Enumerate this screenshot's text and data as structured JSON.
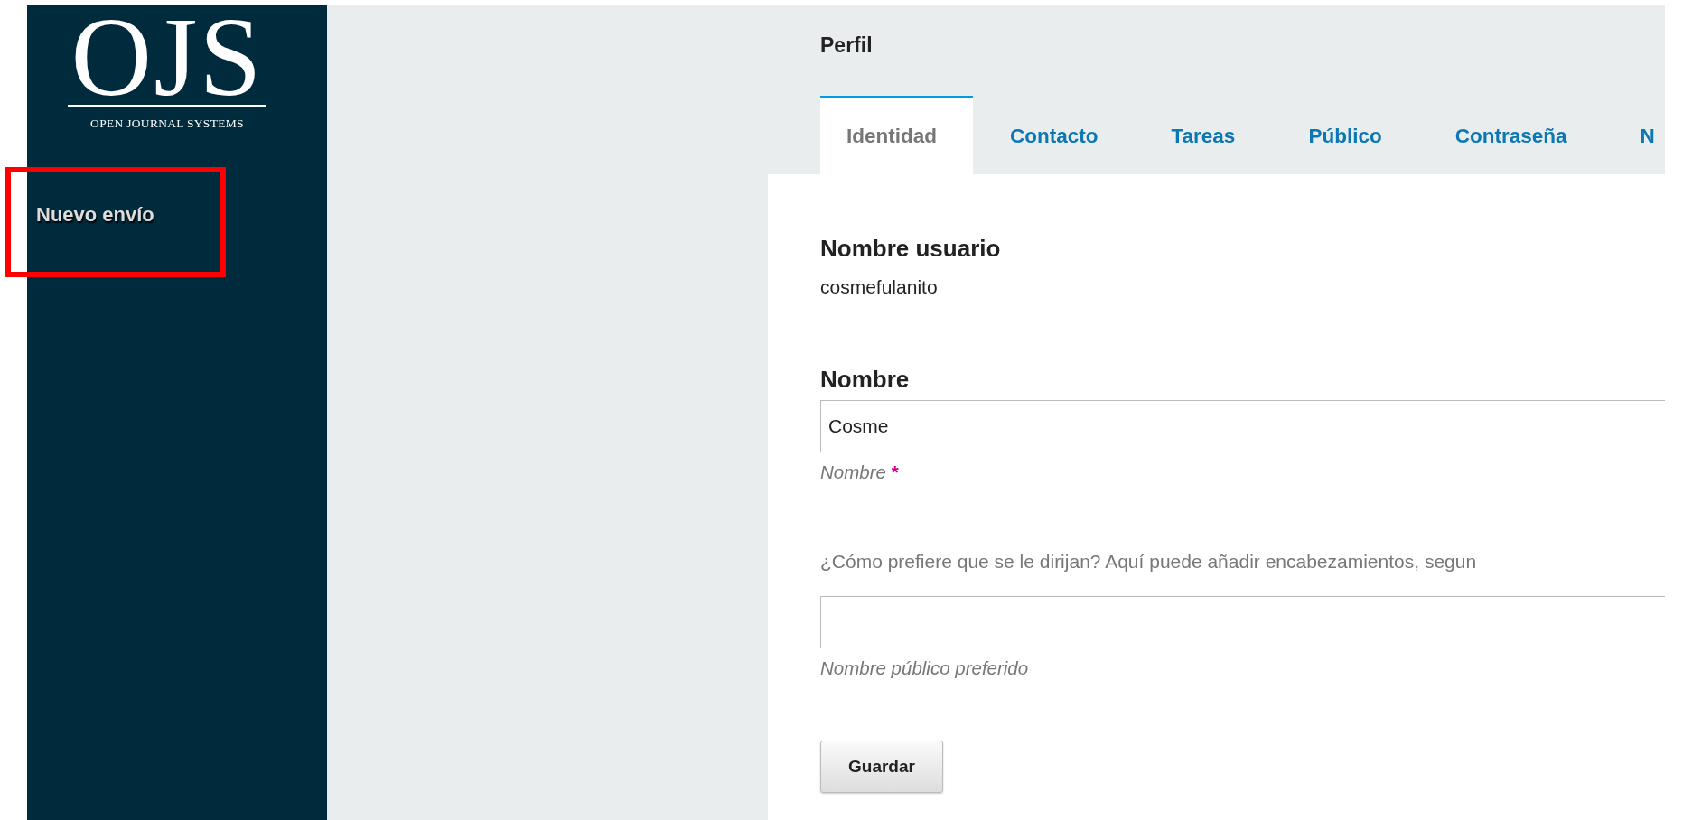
{
  "logo": {
    "title": "OJS",
    "subtitle": "OPEN JOURNAL SYSTEMS"
  },
  "sidebar": {
    "items": [
      {
        "label": "Nuevo envío",
        "highlighted": true
      }
    ]
  },
  "page_title": "Perfil",
  "tabs": [
    {
      "label": "Identidad",
      "selected": true
    },
    {
      "label": "Contacto",
      "selected": false
    },
    {
      "label": "Tareas",
      "selected": false
    },
    {
      "label": "Público",
      "selected": false
    },
    {
      "label": "Contraseña",
      "selected": false
    },
    {
      "label": "N",
      "selected": false
    }
  ],
  "form": {
    "sections": [
      {
        "kind": "readonly",
        "heading": "Nombre usuario",
        "value": "cosmefulanito"
      },
      {
        "kind": "input",
        "heading": "Nombre",
        "value": "Cosme",
        "hint": "Nombre",
        "required_mark": "*"
      },
      {
        "kind": "input",
        "description": "¿Cómo prefiere que se le dirijan? Aquí puede añadir encabezamientos, segun",
        "hint": "Nombre público preferido"
      }
    ],
    "buttons": [
      "Guardar"
    ]
  }
}
